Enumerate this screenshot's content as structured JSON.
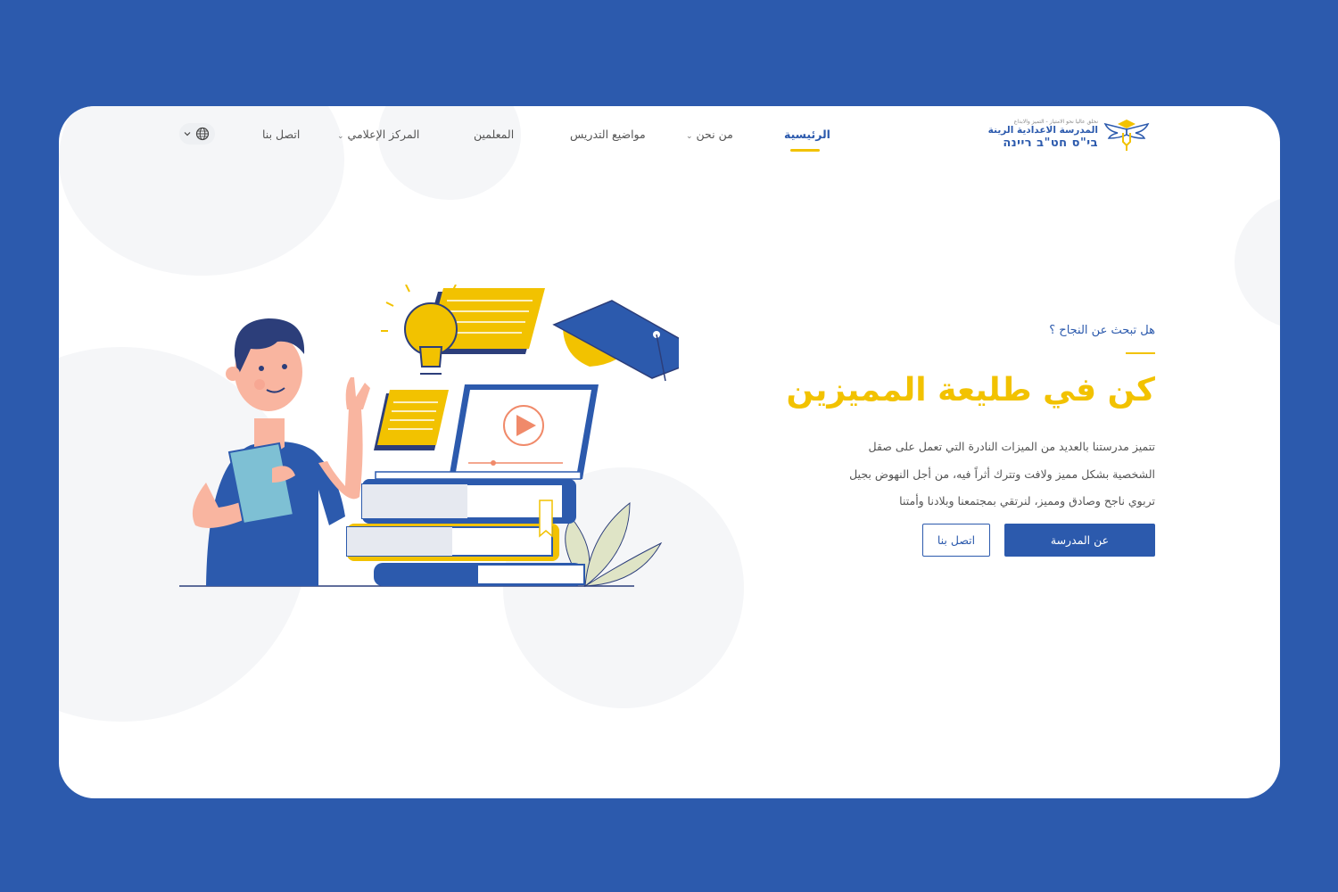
{
  "colors": {
    "page_bg": "#2c5aad",
    "brand_blue": "#2c5aad",
    "accent_yellow": "#f2c200",
    "text_gray": "#555555"
  },
  "logo": {
    "tagline": "نحلق عاليا نحو الامتياز - التميز والابداع",
    "name_ar": "المدرسة الاعدادية الرينة",
    "name_he": "בי\"ס חט\"ב ריינה",
    "icon": "winged-graduation-cap-logo"
  },
  "nav": {
    "home": "الرئيسية",
    "about": "من نحن",
    "subjects": "مواضيع التدريس",
    "teachers": "المعلمين",
    "media": "المركز الإعلامي",
    "contact": "اتصل بنا",
    "language_icon": "globe-icon"
  },
  "hero": {
    "eyebrow": "هل تبحث عن النجاح ؟",
    "title": "كن في طليعة المميزين",
    "text_lines": [
      "تتميز مدرستنا بالعديد من الميزات النادرة التي تعمل على صقل",
      "الشخصية بشكل مميز ولافت وتترك أثراً فيه، من أجل النهوض بجيل",
      "تربوي ناجح وصادق ومميز، لنرتقي بمجتمعنا وبلادنا وأمتنا"
    ],
    "primary_button": "عن المدرسة",
    "secondary_button": "اتصل بنا"
  }
}
